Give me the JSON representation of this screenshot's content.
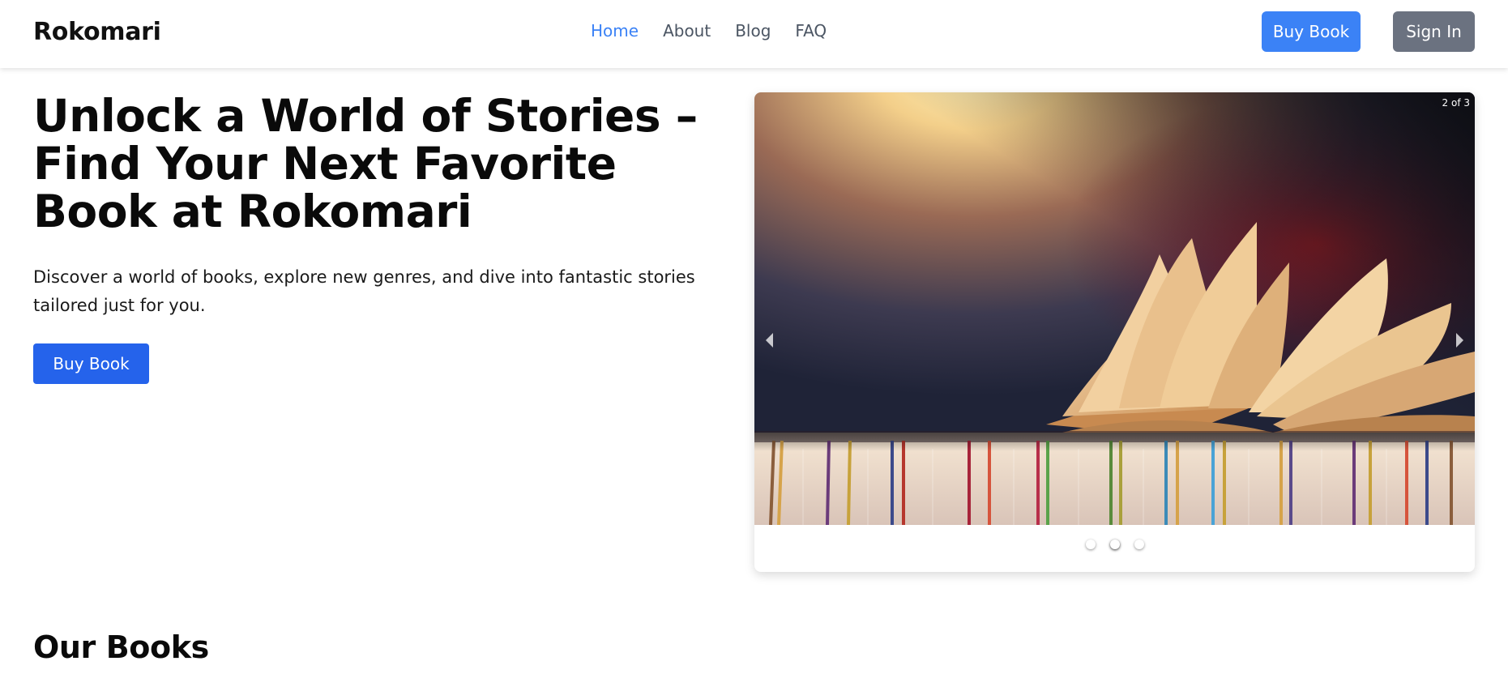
{
  "navbar": {
    "brand": "Rokomari",
    "links": [
      {
        "label": "Home",
        "active": true
      },
      {
        "label": "About",
        "active": false
      },
      {
        "label": "Blog",
        "active": false
      },
      {
        "label": "FAQ",
        "active": false
      }
    ],
    "buy_button": "Buy Book",
    "signin_button": "Sign In"
  },
  "hero": {
    "title": "Unlock a World of Stories – Find Your Next Favorite Book at Rokomari",
    "description": "Discover a world of books, explore new genres, and dive into fantastic stories tailored just for you.",
    "buy_button": "Buy Book"
  },
  "carousel": {
    "counter": "2 of 3",
    "current_slide": 2,
    "total_slides": 3,
    "image_subject": "open book on a row of books",
    "icons": {
      "prev": "chevron-left-icon",
      "next": "chevron-right-icon"
    }
  },
  "section": {
    "title": "Our Books"
  },
  "colors": {
    "accent": "#3b82f6",
    "hero_button": "#2563eb",
    "signin": "#6b7280",
    "nav_text": "#4b5563"
  }
}
